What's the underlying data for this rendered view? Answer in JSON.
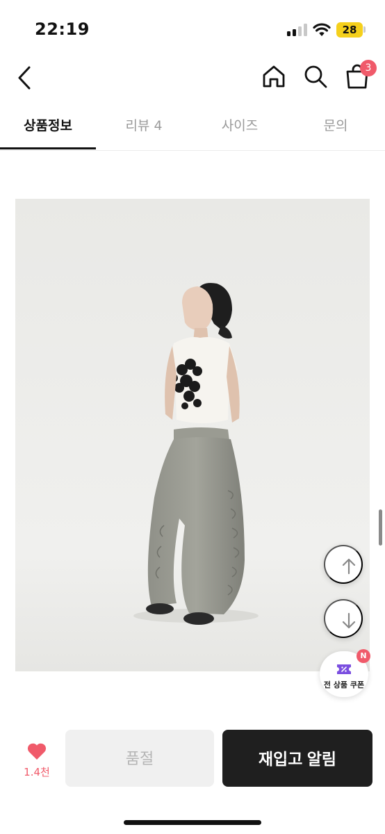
{
  "status_bar": {
    "time": "22:19",
    "battery": "28"
  },
  "header": {
    "cart_count": "3"
  },
  "tabs": [
    {
      "label": "상품정보",
      "active": true
    },
    {
      "label": "리뷰 4",
      "active": false
    },
    {
      "label": "사이즈",
      "active": false
    },
    {
      "label": "문의",
      "active": false
    }
  ],
  "floating": {
    "coupon_label": "전 상품 쿠폰",
    "coupon_badge": "N"
  },
  "bottom_bar": {
    "like_count": "1.4천",
    "soldout_label": "품절",
    "restock_label": "재입고 알림"
  },
  "colors": {
    "accent": "#f05a6a",
    "primary_button": "#1f1f1f",
    "coupon_purple": "#7b4fe0"
  }
}
